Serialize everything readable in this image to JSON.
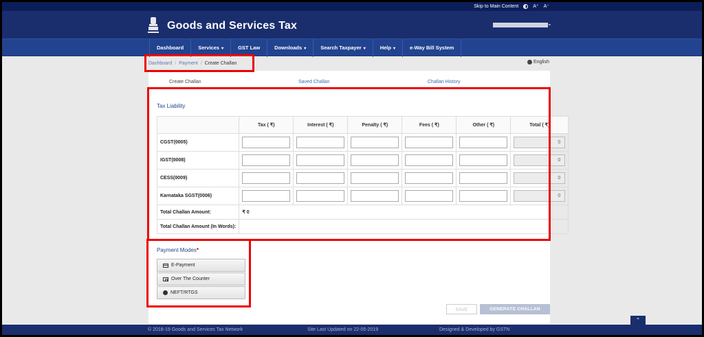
{
  "utility": {
    "skip": "Skip to Main Content",
    "font_large": "A⁺",
    "font_small": "A⁻"
  },
  "header": {
    "title": "Goods and Services Tax",
    "user_caret": "⌄"
  },
  "nav": {
    "items": [
      {
        "label": "Dashboard",
        "caret": ""
      },
      {
        "label": "Services",
        "caret": "▾"
      },
      {
        "label": "GST Law",
        "caret": ""
      },
      {
        "label": "Downloads",
        "caret": "▾"
      },
      {
        "label": "Search Taxpayer",
        "caret": "▾"
      },
      {
        "label": "Help",
        "caret": "▾"
      },
      {
        "label": "e-Way Bill System",
        "caret": ""
      }
    ]
  },
  "breadcrumb": {
    "items": [
      "Dashboard",
      "Payment",
      "Create Challan"
    ],
    "separator": "/"
  },
  "language": "English",
  "tabs": [
    "Create Challan",
    "Saved Challan",
    "Challan History"
  ],
  "liability": {
    "title": "Tax Liability",
    "columns": [
      "",
      "Tax ( ₹)",
      "Interest ( ₹)",
      "Penalty ( ₹)",
      "Fees ( ₹)",
      "Other ( ₹)",
      "Total ( ₹)"
    ],
    "rows": [
      {
        "label": "CGST(0005)",
        "total": "0"
      },
      {
        "label": "IGST(0008)",
        "total": "0"
      },
      {
        "label": "CESS(0009)",
        "total": "0"
      },
      {
        "label": "Karnataka SGST(0006)",
        "total": "0"
      }
    ],
    "total_amount_label": "Total Challan Amount:",
    "total_amount_value": "₹ 0",
    "total_words_label": "Total Challan Amount (In Words):",
    "total_words_value": ""
  },
  "payment": {
    "title": "Payment Modes",
    "required_mark": "*",
    "modes": [
      {
        "label": "E-Payment",
        "icon": "card-icon"
      },
      {
        "label": "Over The Counter",
        "icon": "cash-icon"
      },
      {
        "label": "NEFT/RTGS",
        "icon": "globe-icon"
      }
    ]
  },
  "buttons": {
    "save": "SAVE",
    "generate": "GENERATE CHALLAN"
  },
  "footer": {
    "copyright": "© 2018-19 Goods and Services Tax Network",
    "updated": "Site Last Updated on 22-05-2019",
    "developed": "Designed & Developed by GSTN",
    "scroll_top": "⌃"
  },
  "colors": {
    "header": "#1a2e6e",
    "nav": "#22438f",
    "highlight": "#e00000"
  }
}
